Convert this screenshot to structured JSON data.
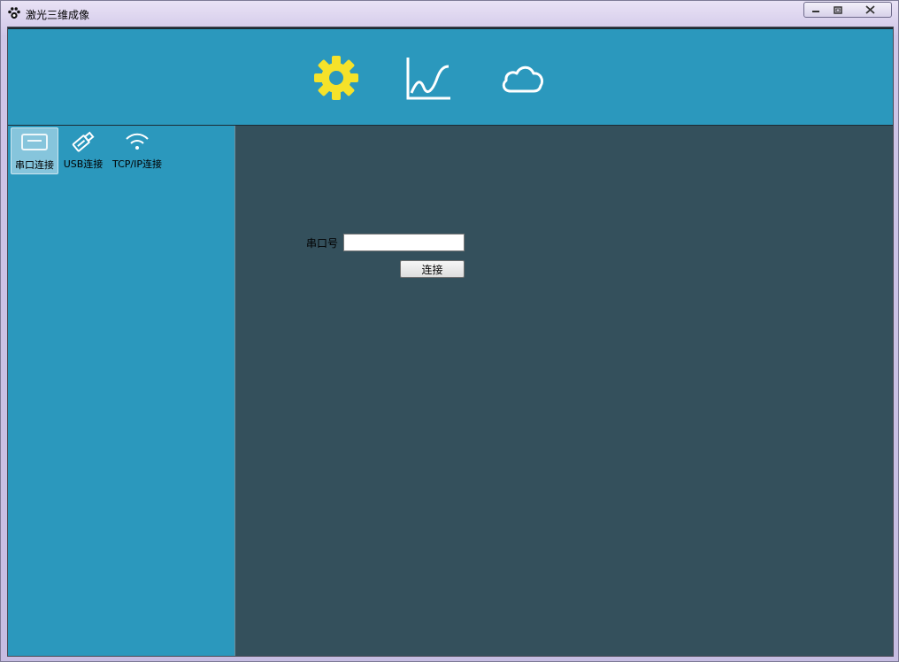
{
  "window": {
    "title": "激光三维成像",
    "controls": {
      "minimize_icon": "minimize-icon",
      "maximize_icon": "maximize-icon",
      "close_icon": "close-icon"
    }
  },
  "toolbar": {
    "icons": [
      {
        "name": "gear-icon",
        "color": "#f5e22a"
      },
      {
        "name": "line-chart-icon",
        "color": "#ffffff"
      },
      {
        "name": "cloud-icon",
        "color": "#ffffff"
      }
    ]
  },
  "sidebar": {
    "tabs": [
      {
        "label": "串口连接",
        "icon": "serial-port-icon",
        "active": true
      },
      {
        "label": "USB连接",
        "icon": "usb-icon",
        "active": false
      },
      {
        "label": "TCP/IP连接",
        "icon": "wifi-icon",
        "active": false
      }
    ]
  },
  "form": {
    "port_label": "串口号",
    "port_value": "",
    "connect_label": "连接"
  },
  "colors": {
    "header_bg": "#2b98bd",
    "content_bg": "#34505c",
    "gear": "#f5e22a"
  }
}
